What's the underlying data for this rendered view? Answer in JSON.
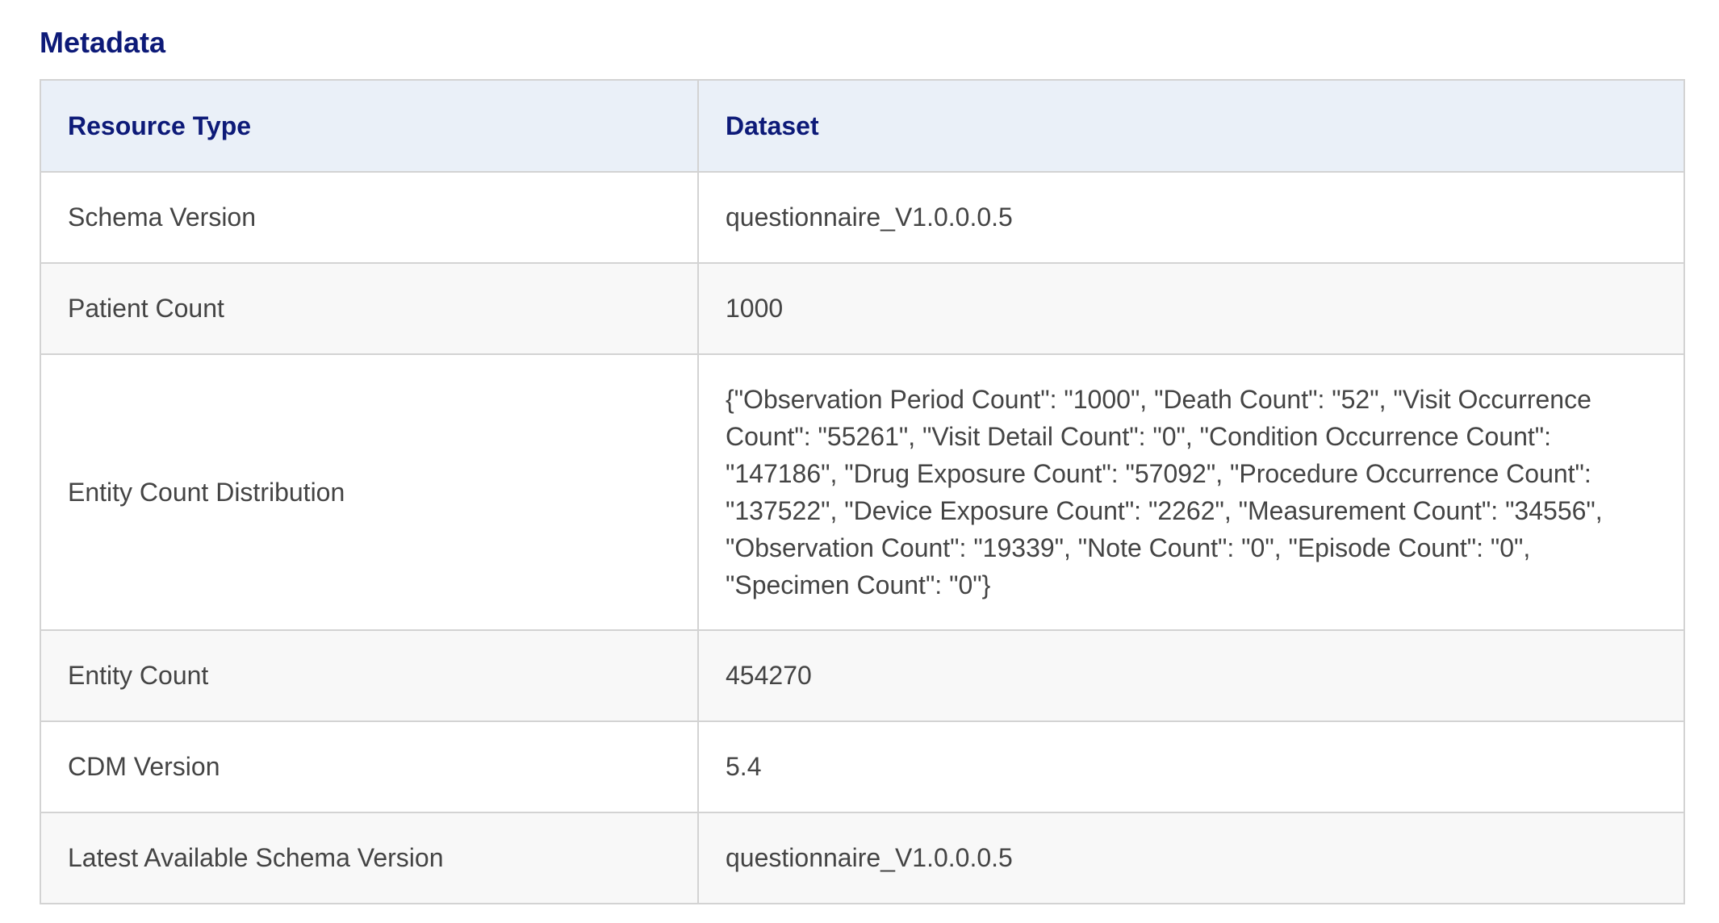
{
  "section": {
    "title": "Metadata"
  },
  "table": {
    "headers": [
      "Resource Type",
      "Dataset"
    ],
    "rows": [
      {
        "key": "Schema Version",
        "value": "questionnaire_V1.0.0.0.5"
      },
      {
        "key": "Patient Count",
        "value": "1000"
      },
      {
        "key": "Entity Count Distribution",
        "value": "{\"Observation Period Count\": \"1000\", \"Death Count\": \"52\", \"Visit Occurrence Count\": \"55261\", \"Visit Detail Count\": \"0\", \"Condition Occurrence Count\": \"147186\", \"Drug Exposure Count\": \"57092\", \"Procedure Occurrence Count\": \"137522\", \"Device Exposure Count\": \"2262\", \"Measurement Count\": \"34556\", \"Observation Count\": \"19339\", \"Note Count\": \"0\", \"Episode Count\": \"0\", \"Specimen Count\": \"0\"}"
      },
      {
        "key": "Entity Count",
        "value": "454270"
      },
      {
        "key": "CDM Version",
        "value": "5.4"
      },
      {
        "key": "Latest Available Schema Version",
        "value": "questionnaire_V1.0.0.0.5"
      }
    ]
  },
  "colors": {
    "title": "#0d1a78",
    "header_bg": "#eaf0f8",
    "alt_row_bg": "#f8f8f8",
    "border": "#d3d3d3"
  }
}
